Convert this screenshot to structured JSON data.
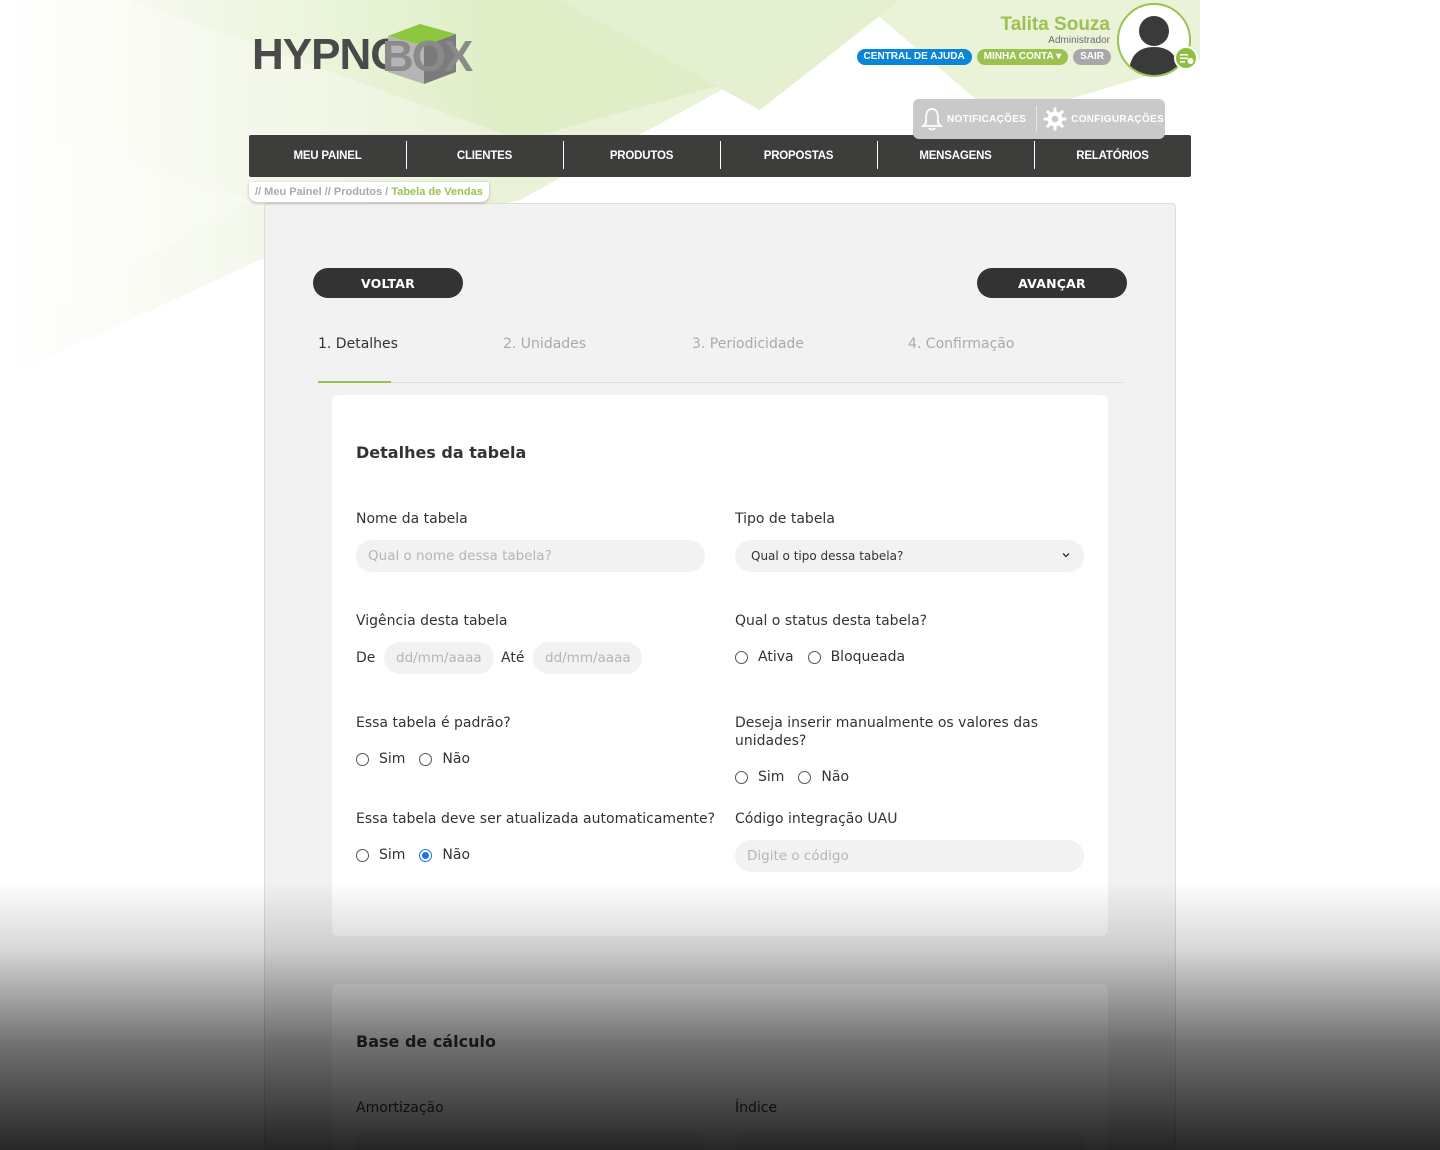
{
  "brand": {
    "logo_primary": "HYPNO",
    "logo_secondary": "BOX",
    "accent": "#9bc251",
    "dark": "#333333"
  },
  "user": {
    "name": "Talita Souza",
    "role": "Administrador",
    "links": {
      "help": "CENTRAL DE AJUDA",
      "account": "MINHA CONTA ▾",
      "logout": "SAIR"
    }
  },
  "toolbar": {
    "notifications": "NOTIFICAÇÕES",
    "settings": "CONFIGURAÇÕES"
  },
  "nav": [
    "MEU PAINEL",
    "CLIENTES",
    "PRODUTOS",
    "PROPOSTAS",
    "MENSAGENS",
    "RELATÓRIOS"
  ],
  "breadcrumb": {
    "prefix": "// Meu Painel // Produtos /",
    "current": "Tabela de Vendas"
  },
  "actions": {
    "back": "VOLTAR",
    "next": "AVANÇAR"
  },
  "steps": [
    "1. Detalhes",
    "2. Unidades",
    "3. Periodicidade",
    "4. Confirmação"
  ],
  "details": {
    "title": "Detalhes da tabela",
    "table_name": {
      "label": "Nome da tabela",
      "placeholder": "Qual o nome dessa tabela?"
    },
    "table_type": {
      "label": "Tipo de tabela",
      "selected": "Qual o tipo dessa tabela?"
    },
    "validity": {
      "label": "Vigência desta tabela",
      "from": "De",
      "to": "Até",
      "from_placeholder": "dd/mm/aaaa",
      "to_placeholder": "dd/mm/aaaa"
    },
    "status": {
      "label": "Qual o status desta tabela?",
      "options": [
        "Ativa",
        "Bloqueada"
      ]
    },
    "is_default": {
      "label": "Essa tabela é padrão?",
      "options": [
        "Sim",
        "Não"
      ]
    },
    "manual_values": {
      "label": "Deseja inserir manualmente os valores das unidades?",
      "options": [
        "Sim",
        "Não"
      ]
    },
    "auto_update": {
      "label": "Essa tabela deve ser atualizada automaticamente?",
      "options": [
        "Sim",
        "Não"
      ],
      "selected": "Não"
    },
    "uau_code": {
      "label": "Código integração UAU",
      "placeholder": "Digite o código"
    }
  },
  "calc": {
    "title": "Base de cálculo",
    "amortization_label": "Amortização",
    "index_label": "Índice"
  }
}
